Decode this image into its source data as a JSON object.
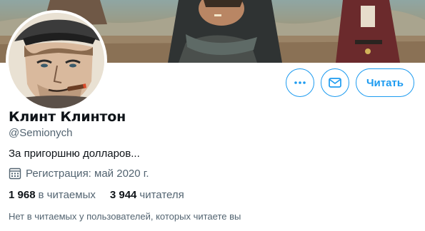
{
  "profile": {
    "name": "Клинт Клинтон",
    "handle": "@Semionych",
    "bio": "За пригоршню долларов...",
    "joined": "Регистрация: май 2020 г."
  },
  "actions": {
    "more_icon": "more-dots-icon",
    "message_icon": "envelope-icon",
    "follow_label": "Читать"
  },
  "stats": {
    "following_count": "1 968",
    "following_label": "в читаемых",
    "followers_count": "3 944",
    "followers_label": "читателя"
  },
  "mutual_followers": "Нет в читаемых у пользователей, которых читаете вы",
  "colors": {
    "accent": "#1d9bf0",
    "text_primary": "#0f1419",
    "text_secondary": "#536471"
  }
}
